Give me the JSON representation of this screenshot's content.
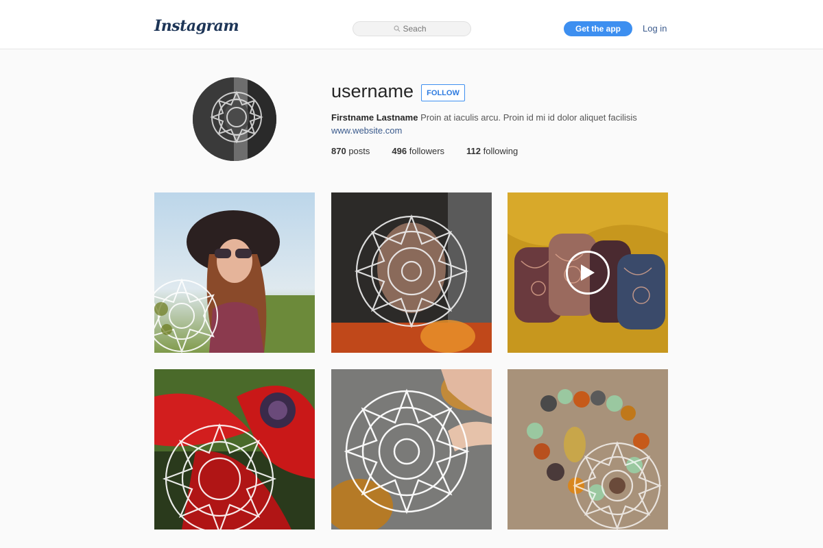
{
  "header": {
    "logo": "Instagram",
    "search_placeholder": "Seach",
    "get_app_label": "Get the app",
    "login_label": "Log in"
  },
  "profile": {
    "username": "username",
    "follow_label": "FOLLOW",
    "full_name": "Firstname Lastname",
    "bio": "Proin at iaculis arcu. Proin id mi id dolor aliquet facilisis",
    "website": "www.website.com",
    "stats": [
      {
        "value": "870",
        "label": "posts"
      },
      {
        "value": "496",
        "label": "followers"
      },
      {
        "value": "112",
        "label": "following"
      }
    ]
  },
  "posts": [
    {
      "type": "photo",
      "description": "woman-with-hat-and-sunglasses"
    },
    {
      "type": "photo",
      "description": "face-portrait-with-mandala"
    },
    {
      "type": "video",
      "description": "engraved-copper-bracelets"
    },
    {
      "type": "photo",
      "description": "red-flower-closeup"
    },
    {
      "type": "photo",
      "description": "knitting-yarn-with-mandala"
    },
    {
      "type": "photo",
      "description": "beaded-bracelet-on-burlap"
    }
  ],
  "colors": {
    "accent": "#3d8ff0",
    "link": "#3a5a8c",
    "background": "#fafafa"
  }
}
